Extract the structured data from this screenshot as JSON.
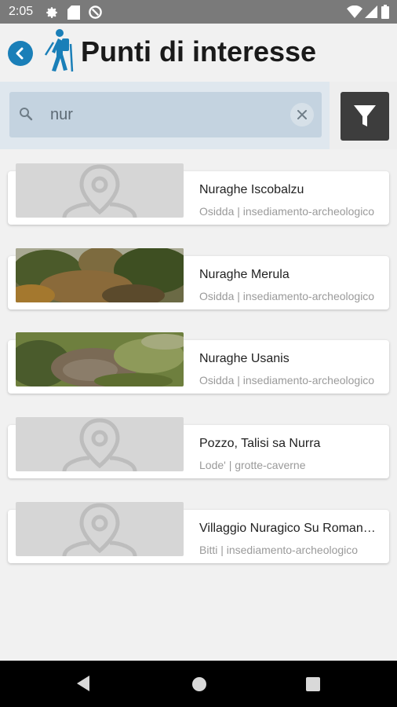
{
  "status_bar": {
    "time": "2:05",
    "left_icons": [
      "gear-icon",
      "sd-card-icon",
      "data-saver-icon"
    ],
    "right_icons": [
      "wifi-icon",
      "signal-icon",
      "battery-icon"
    ]
  },
  "header": {
    "title": "Punti di interesse",
    "back_icon": "back-arrow-icon",
    "logo_icon": "hiker-icon",
    "accent_color": "#1a7fb8"
  },
  "search": {
    "value": "nur",
    "search_icon": "search-icon",
    "clear_icon": "close-icon",
    "filter_icon": "filter-icon"
  },
  "results": [
    {
      "name": "Nuraghe Iscobalzu",
      "meta": "Osidda | insediamento-archeologico",
      "image": "placeholder"
    },
    {
      "name": "Nuraghe Merula",
      "meta": "Osidda | insediamento-archeologico",
      "image": "photo"
    },
    {
      "name": "Nuraghe Usanis",
      "meta": "Osidda | insediamento-archeologico",
      "image": "photo"
    },
    {
      "name": "Pozzo, Talisi sa Nurra",
      "meta": "Lode' | grotte-caverne",
      "image": "placeholder"
    },
    {
      "name": "Villaggio Nuragico Su Romanzesu",
      "meta": "Bitti | insediamento-archeologico",
      "image": "placeholder"
    }
  ],
  "nav_bar": {
    "icons": [
      "nav-back-icon",
      "nav-home-icon",
      "nav-recents-icon"
    ]
  }
}
